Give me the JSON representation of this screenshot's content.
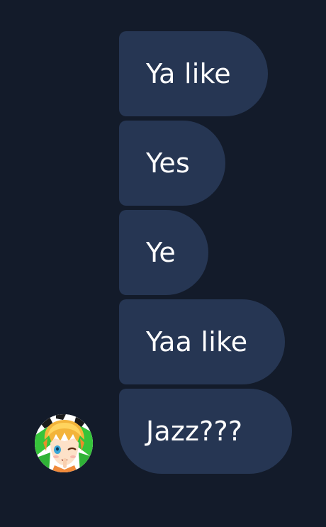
{
  "colors": {
    "background": "#131b2a",
    "bubble": "#263653",
    "text": "#ffffff"
  },
  "messages": [
    {
      "text": "Ya like"
    },
    {
      "text": "Yes"
    },
    {
      "text": "Ye"
    },
    {
      "text": "Yaa like"
    },
    {
      "text": "Jazz???"
    }
  ],
  "sender": {
    "avatar_icon": "anime-character-avatar-icon"
  }
}
